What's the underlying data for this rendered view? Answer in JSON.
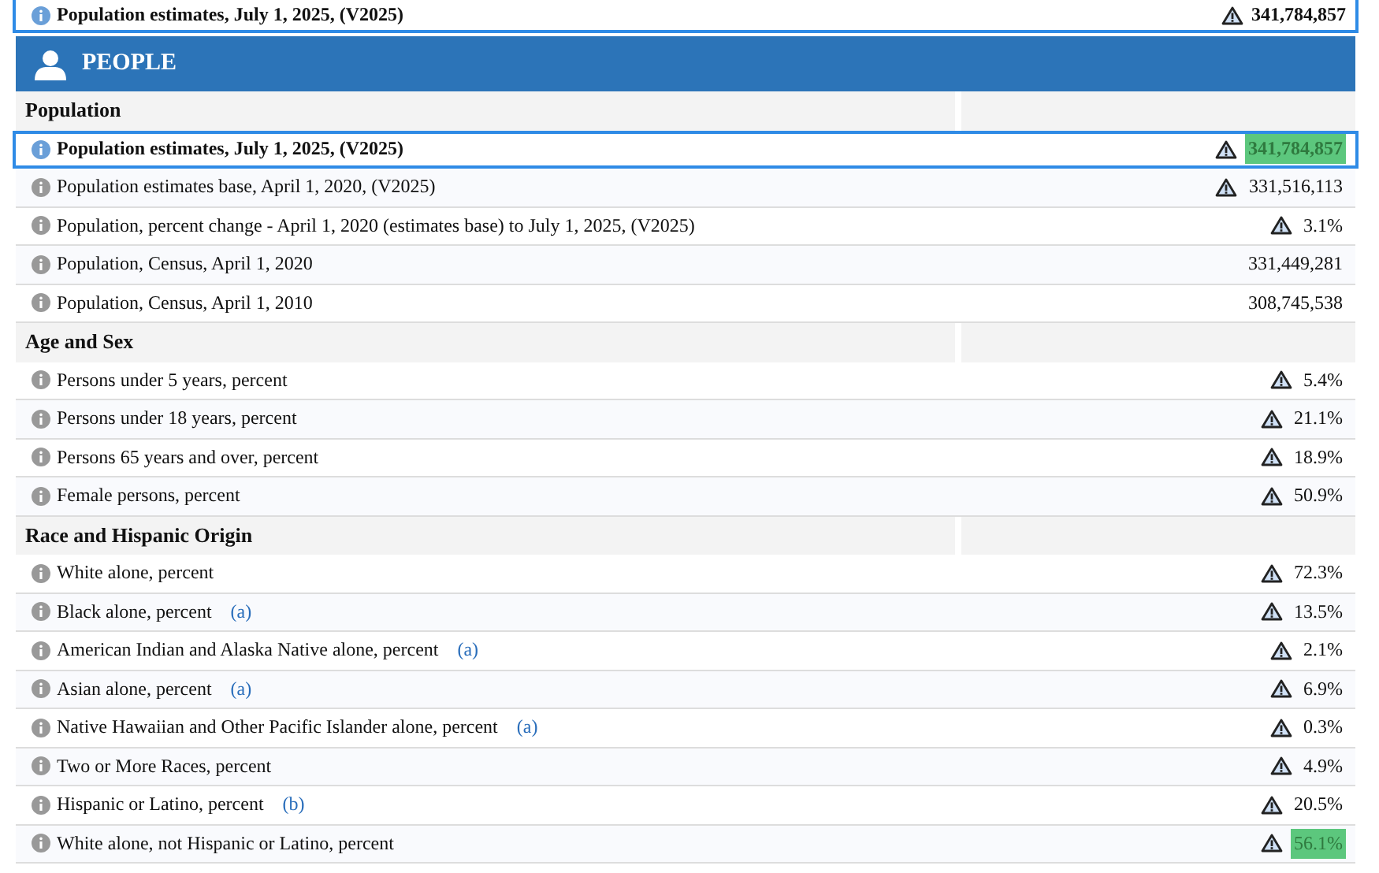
{
  "sticky_row": {
    "label": "Population estimates, July 1, 2025, (V2025)",
    "value": "341,784,857",
    "flagged": true
  },
  "section": {
    "title": "PEOPLE"
  },
  "groups": [
    {
      "title": "Population",
      "rows": [
        {
          "label": "Population estimates, July 1, 2025, (V2025)",
          "value": "341,784,857",
          "flagged": true,
          "selected": true,
          "highlighted": true
        },
        {
          "label": "Population estimates base, April 1, 2020, (V2025)",
          "value": "331,516,113",
          "flagged": true,
          "selected": false,
          "highlighted": false
        },
        {
          "label": "Population, percent change - April 1, 2020 (estimates base) to July 1, 2025, (V2025)",
          "value": "3.1%",
          "flagged": true,
          "selected": false,
          "highlighted": false
        },
        {
          "label": "Population, Census, April 1, 2020",
          "value": "331,449,281",
          "flagged": false,
          "selected": false,
          "highlighted": false
        },
        {
          "label": "Population, Census, April 1, 2010",
          "value": "308,745,538",
          "flagged": false,
          "selected": false,
          "highlighted": false
        }
      ]
    },
    {
      "title": "Age and Sex",
      "rows": [
        {
          "label": "Persons under 5 years, percent",
          "value": "5.4%",
          "flagged": true,
          "selected": false,
          "highlighted": false
        },
        {
          "label": "Persons under 18 years, percent",
          "value": "21.1%",
          "flagged": true,
          "selected": false,
          "highlighted": false
        },
        {
          "label": "Persons 65 years and over, percent",
          "value": "18.9%",
          "flagged": true,
          "selected": false,
          "highlighted": false
        },
        {
          "label": "Female persons, percent",
          "value": "50.9%",
          "flagged": true,
          "selected": false,
          "highlighted": false
        }
      ]
    },
    {
      "title": "Race and Hispanic Origin",
      "rows": [
        {
          "label": "White alone, percent",
          "value": "72.3%",
          "flagged": true,
          "selected": false,
          "highlighted": false
        },
        {
          "label": "Black alone, percent",
          "note": "(a)",
          "value": "13.5%",
          "flagged": true,
          "selected": false,
          "highlighted": false
        },
        {
          "label": "American Indian and Alaska Native alone, percent",
          "note": "(a)",
          "value": "2.1%",
          "flagged": true,
          "selected": false,
          "highlighted": false
        },
        {
          "label": "Asian alone, percent",
          "note": "(a)",
          "value": "6.9%",
          "flagged": true,
          "selected": false,
          "highlighted": false
        },
        {
          "label": "Native Hawaiian and Other Pacific Islander alone, percent",
          "note": "(a)",
          "value": "0.3%",
          "flagged": true,
          "selected": false,
          "highlighted": false
        },
        {
          "label": "Two or More Races, percent",
          "value": "4.9%",
          "flagged": true,
          "selected": false,
          "highlighted": false
        },
        {
          "label": "Hispanic or Latino, percent",
          "note": "(b)",
          "value": "20.5%",
          "flagged": true,
          "selected": false,
          "highlighted": false
        },
        {
          "label": "White alone, not Hispanic or Latino, percent",
          "value": "56.1%",
          "flagged": true,
          "selected": false,
          "highlighted": true
        }
      ]
    }
  ]
}
